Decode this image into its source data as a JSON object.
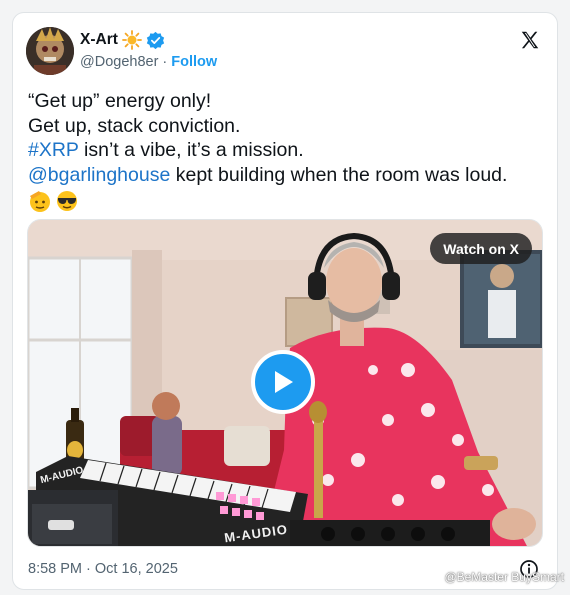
{
  "tweet": {
    "display_name": "X-Art",
    "name_emoji": "sun-emoji",
    "verified_icon": "verified-badge-icon",
    "handle": "@Dogeh8er",
    "separator": "·",
    "follow_label": "Follow",
    "lines": [
      {
        "parts": [
          {
            "text": "“Get up” energy only!",
            "type": "text"
          }
        ]
      },
      {
        "parts": [
          {
            "text": "Get up, stack conviction.",
            "type": "text"
          }
        ]
      },
      {
        "parts": [
          {
            "text": "#XRP",
            "type": "link"
          },
          {
            "text": " isn’t a vibe, it’s a mission.",
            "type": "text"
          }
        ]
      },
      {
        "parts": [
          {
            "text": "@bgarlinghouse",
            "type": "link"
          },
          {
            "text": " kept building when the room was loud.",
            "type": "text"
          }
        ]
      }
    ],
    "trailing_emojis": [
      "saluting-face-emoji",
      "sunglasses-face-emoji"
    ],
    "timestamp": "8:58 PM · Oct 16, 2025"
  },
  "media": {
    "watch_label": "Watch on X",
    "play_icon": "play-icon",
    "keyboard_brand": "M-AUDIO",
    "controller_brand": "M-AUDIO"
  },
  "header": {
    "close_icon": "x-logo-icon"
  },
  "watermark": "@BeMaster BuySmart",
  "colors": {
    "accent": "#1d9bf0",
    "link": "#1d74c8",
    "robe": "#e8345e"
  }
}
